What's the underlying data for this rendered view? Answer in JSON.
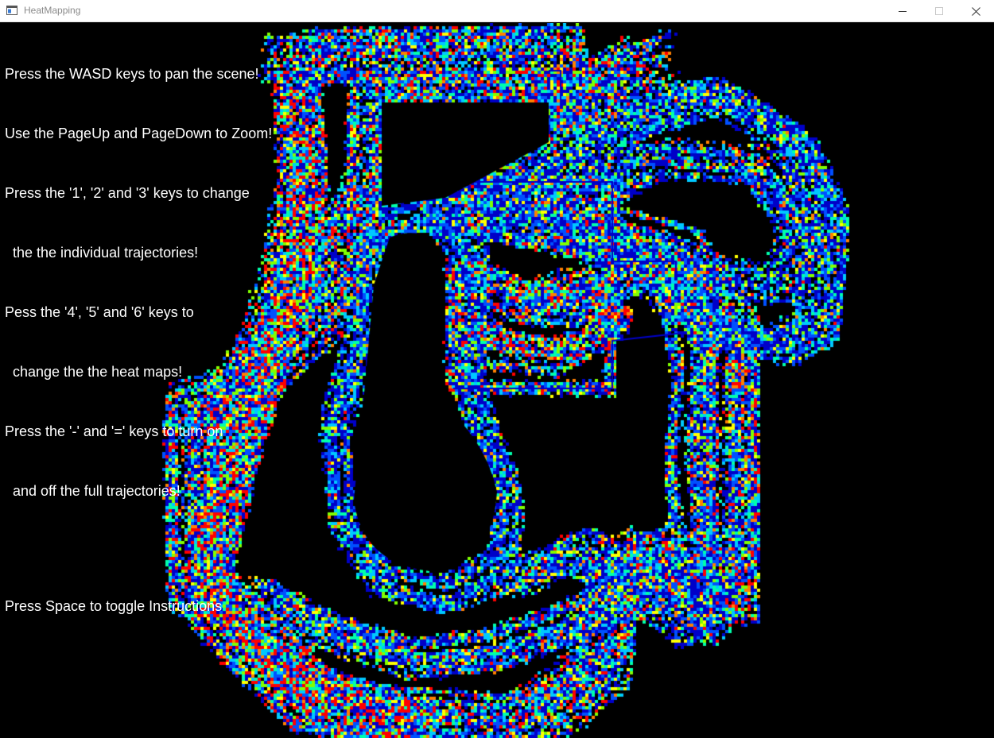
{
  "window": {
    "title": "HeatMapping",
    "controls": {
      "minimize": "minimize-icon",
      "maximize": "maximize-icon",
      "close": "close-icon"
    }
  },
  "instructions": {
    "lines": [
      "Press the WASD keys to pan the scene!",
      "Use the PageUp and PageDown to Zoom!",
      "Press the '1', '2' and '3' keys to change",
      "  the the individual trajectories!",
      "Pess the '4', '5' and '6' keys to",
      "  change the the heat maps!",
      "Press the '-' and '=' keys to turn on",
      "  and off the full trajectories!"
    ],
    "toggle_line": "Press Space to toggle Instructions"
  },
  "heatmap": {
    "background": "#000000",
    "palette": [
      "#0000c8",
      "#0050ff",
      "#00c8ff",
      "#00ffaa",
      "#80ff00",
      "#ffff00",
      "#ff8000",
      "#ff0000"
    ]
  }
}
